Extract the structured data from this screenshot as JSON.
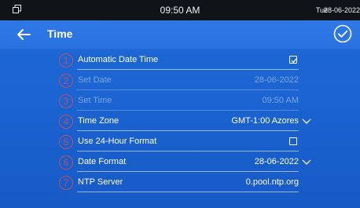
{
  "status_bar": {
    "clock": "09:50 AM",
    "day": "Tue",
    "date": "28-06-2022",
    "window_icon": "window-restore-icon"
  },
  "header": {
    "title": "Time",
    "back_icon": "arrow-left-icon",
    "confirm_icon": "check-circle-icon"
  },
  "settings": [
    {
      "number": "1",
      "label": "Automatic Date Time",
      "type": "checkbox",
      "checked": true,
      "enabled": true
    },
    {
      "number": "2",
      "label": "Set Date",
      "value": "28-06-2022",
      "enabled": false
    },
    {
      "number": "3",
      "label": "Set Time",
      "value": "09:50 AM",
      "enabled": false
    },
    {
      "number": "4",
      "label": "Time Zone",
      "value": "GMT-1:00 Azores",
      "dropdown": true,
      "enabled": true
    },
    {
      "number": "5",
      "label": "Use 24-Hour Format",
      "type": "checkbox",
      "checked": false,
      "enabled": true
    },
    {
      "number": "6",
      "label": "Date Format",
      "value": "28-06-2022",
      "dropdown": true,
      "enabled": true
    },
    {
      "number": "7",
      "label": "NTP Server",
      "value": "0.pool.ntp.org",
      "type": "input",
      "enabled": true
    }
  ],
  "colors": {
    "panel": "#1b64d2",
    "title_bar": "#2a72e0",
    "status_bar": "#101318",
    "annotation": "#e84b4b"
  }
}
